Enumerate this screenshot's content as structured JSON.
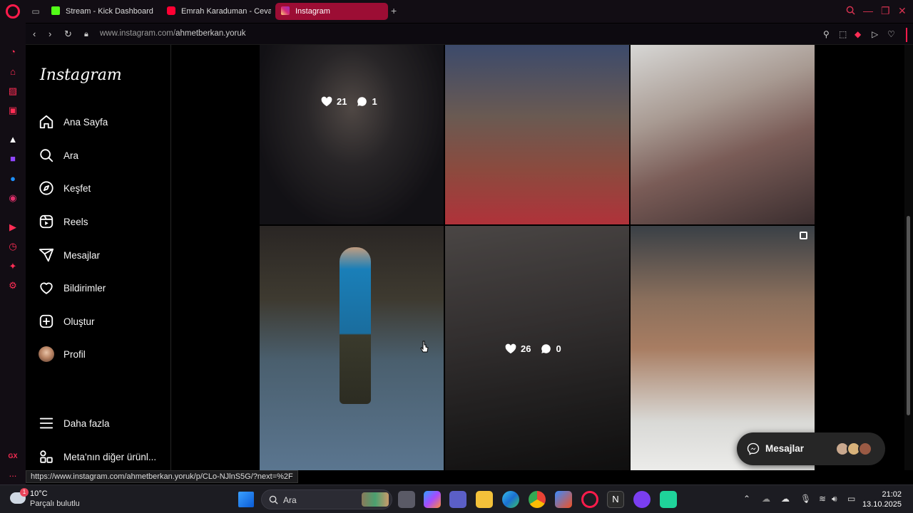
{
  "browser": {
    "tabs": [
      {
        "label": "Stream - Kick Dashboard",
        "icon": "kick-icon",
        "color": "#53fc18"
      },
      {
        "label": "Emrah Karaduman - Cevap",
        "icon": "youtube-icon",
        "color": "#ff0033"
      },
      {
        "label": "Instagram",
        "icon": "instagram-icon",
        "color": "#e1306c",
        "active": true
      }
    ],
    "url_host": "www.instagram.com/",
    "url_path": "ahmetberkan.yoruk",
    "status_url": "https://www.instagram.com/ahmetberkan.yoruk/p/CLo-NJlnS5G/?next=%2F",
    "accent": "#ff1b4b"
  },
  "instagram": {
    "logo": "Instagram",
    "nav": [
      {
        "label": "Ana Sayfa",
        "icon": "home-icon"
      },
      {
        "label": "Ara",
        "icon": "search-icon"
      },
      {
        "label": "Keşfet",
        "icon": "explore-compass-icon"
      },
      {
        "label": "Reels",
        "icon": "reels-icon"
      },
      {
        "label": "Mesajlar",
        "icon": "send-icon"
      },
      {
        "label": "Bildirimler",
        "icon": "heart-icon"
      },
      {
        "label": "Oluştur",
        "icon": "create-plus-icon"
      },
      {
        "label": "Profil",
        "icon": "avatar"
      }
    ],
    "more": "Daha fazla",
    "meta": "Meta'nın diğer ürünl...",
    "posts": [
      {
        "likes": "21",
        "comments": "1",
        "hover": true
      },
      {
        "hover": false
      },
      {
        "hover": false
      },
      {
        "hover": false
      },
      {
        "likes": "26",
        "comments": "0",
        "hover": true
      },
      {
        "hover": false,
        "multi": true
      }
    ],
    "messages_label": "Mesajlar"
  },
  "taskbar": {
    "weather_temp": "10°C",
    "weather_cond": "Parçalı bulutlu",
    "weather_badge": "1",
    "search_placeholder": "Ara",
    "time": "21:02",
    "date": "13.10.2025"
  },
  "opera_sidebar": {
    "gx_label": "GX",
    "more_label": "..."
  }
}
